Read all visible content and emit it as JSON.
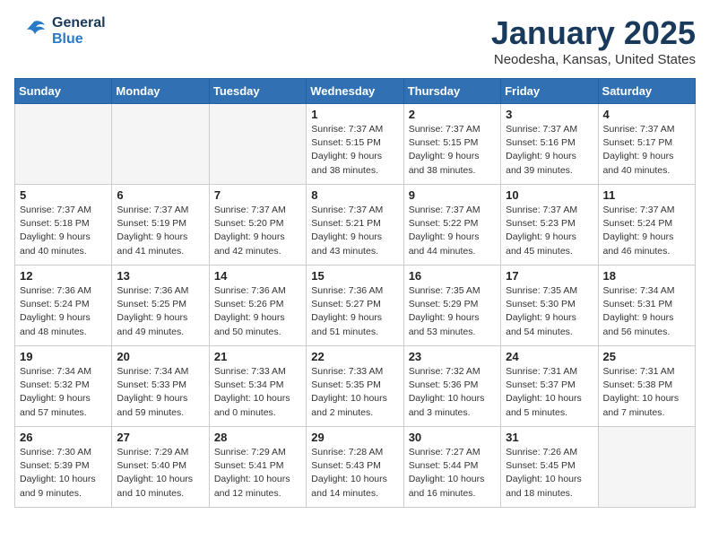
{
  "header": {
    "logo_general": "General",
    "logo_blue": "Blue",
    "title": "January 2025",
    "subtitle": "Neodesha, Kansas, United States"
  },
  "calendar": {
    "days_of_week": [
      "Sunday",
      "Monday",
      "Tuesday",
      "Wednesday",
      "Thursday",
      "Friday",
      "Saturday"
    ],
    "weeks": [
      [
        {
          "day": "",
          "info": ""
        },
        {
          "day": "",
          "info": ""
        },
        {
          "day": "",
          "info": ""
        },
        {
          "day": "1",
          "info": "Sunrise: 7:37 AM\nSunset: 5:15 PM\nDaylight: 9 hours\nand 38 minutes."
        },
        {
          "day": "2",
          "info": "Sunrise: 7:37 AM\nSunset: 5:15 PM\nDaylight: 9 hours\nand 38 minutes."
        },
        {
          "day": "3",
          "info": "Sunrise: 7:37 AM\nSunset: 5:16 PM\nDaylight: 9 hours\nand 39 minutes."
        },
        {
          "day": "4",
          "info": "Sunrise: 7:37 AM\nSunset: 5:17 PM\nDaylight: 9 hours\nand 40 minutes."
        }
      ],
      [
        {
          "day": "5",
          "info": "Sunrise: 7:37 AM\nSunset: 5:18 PM\nDaylight: 9 hours\nand 40 minutes."
        },
        {
          "day": "6",
          "info": "Sunrise: 7:37 AM\nSunset: 5:19 PM\nDaylight: 9 hours\nand 41 minutes."
        },
        {
          "day": "7",
          "info": "Sunrise: 7:37 AM\nSunset: 5:20 PM\nDaylight: 9 hours\nand 42 minutes."
        },
        {
          "day": "8",
          "info": "Sunrise: 7:37 AM\nSunset: 5:21 PM\nDaylight: 9 hours\nand 43 minutes."
        },
        {
          "day": "9",
          "info": "Sunrise: 7:37 AM\nSunset: 5:22 PM\nDaylight: 9 hours\nand 44 minutes."
        },
        {
          "day": "10",
          "info": "Sunrise: 7:37 AM\nSunset: 5:23 PM\nDaylight: 9 hours\nand 45 minutes."
        },
        {
          "day": "11",
          "info": "Sunrise: 7:37 AM\nSunset: 5:24 PM\nDaylight: 9 hours\nand 46 minutes."
        }
      ],
      [
        {
          "day": "12",
          "info": "Sunrise: 7:36 AM\nSunset: 5:24 PM\nDaylight: 9 hours\nand 48 minutes."
        },
        {
          "day": "13",
          "info": "Sunrise: 7:36 AM\nSunset: 5:25 PM\nDaylight: 9 hours\nand 49 minutes."
        },
        {
          "day": "14",
          "info": "Sunrise: 7:36 AM\nSunset: 5:26 PM\nDaylight: 9 hours\nand 50 minutes."
        },
        {
          "day": "15",
          "info": "Sunrise: 7:36 AM\nSunset: 5:27 PM\nDaylight: 9 hours\nand 51 minutes."
        },
        {
          "day": "16",
          "info": "Sunrise: 7:35 AM\nSunset: 5:29 PM\nDaylight: 9 hours\nand 53 minutes."
        },
        {
          "day": "17",
          "info": "Sunrise: 7:35 AM\nSunset: 5:30 PM\nDaylight: 9 hours\nand 54 minutes."
        },
        {
          "day": "18",
          "info": "Sunrise: 7:34 AM\nSunset: 5:31 PM\nDaylight: 9 hours\nand 56 minutes."
        }
      ],
      [
        {
          "day": "19",
          "info": "Sunrise: 7:34 AM\nSunset: 5:32 PM\nDaylight: 9 hours\nand 57 minutes."
        },
        {
          "day": "20",
          "info": "Sunrise: 7:34 AM\nSunset: 5:33 PM\nDaylight: 9 hours\nand 59 minutes."
        },
        {
          "day": "21",
          "info": "Sunrise: 7:33 AM\nSunset: 5:34 PM\nDaylight: 10 hours\nand 0 minutes."
        },
        {
          "day": "22",
          "info": "Sunrise: 7:33 AM\nSunset: 5:35 PM\nDaylight: 10 hours\nand 2 minutes."
        },
        {
          "day": "23",
          "info": "Sunrise: 7:32 AM\nSunset: 5:36 PM\nDaylight: 10 hours\nand 3 minutes."
        },
        {
          "day": "24",
          "info": "Sunrise: 7:31 AM\nSunset: 5:37 PM\nDaylight: 10 hours\nand 5 minutes."
        },
        {
          "day": "25",
          "info": "Sunrise: 7:31 AM\nSunset: 5:38 PM\nDaylight: 10 hours\nand 7 minutes."
        }
      ],
      [
        {
          "day": "26",
          "info": "Sunrise: 7:30 AM\nSunset: 5:39 PM\nDaylight: 10 hours\nand 9 minutes."
        },
        {
          "day": "27",
          "info": "Sunrise: 7:29 AM\nSunset: 5:40 PM\nDaylight: 10 hours\nand 10 minutes."
        },
        {
          "day": "28",
          "info": "Sunrise: 7:29 AM\nSunset: 5:41 PM\nDaylight: 10 hours\nand 12 minutes."
        },
        {
          "day": "29",
          "info": "Sunrise: 7:28 AM\nSunset: 5:43 PM\nDaylight: 10 hours\nand 14 minutes."
        },
        {
          "day": "30",
          "info": "Sunrise: 7:27 AM\nSunset: 5:44 PM\nDaylight: 10 hours\nand 16 minutes."
        },
        {
          "day": "31",
          "info": "Sunrise: 7:26 AM\nSunset: 5:45 PM\nDaylight: 10 hours\nand 18 minutes."
        },
        {
          "day": "",
          "info": ""
        }
      ]
    ]
  }
}
